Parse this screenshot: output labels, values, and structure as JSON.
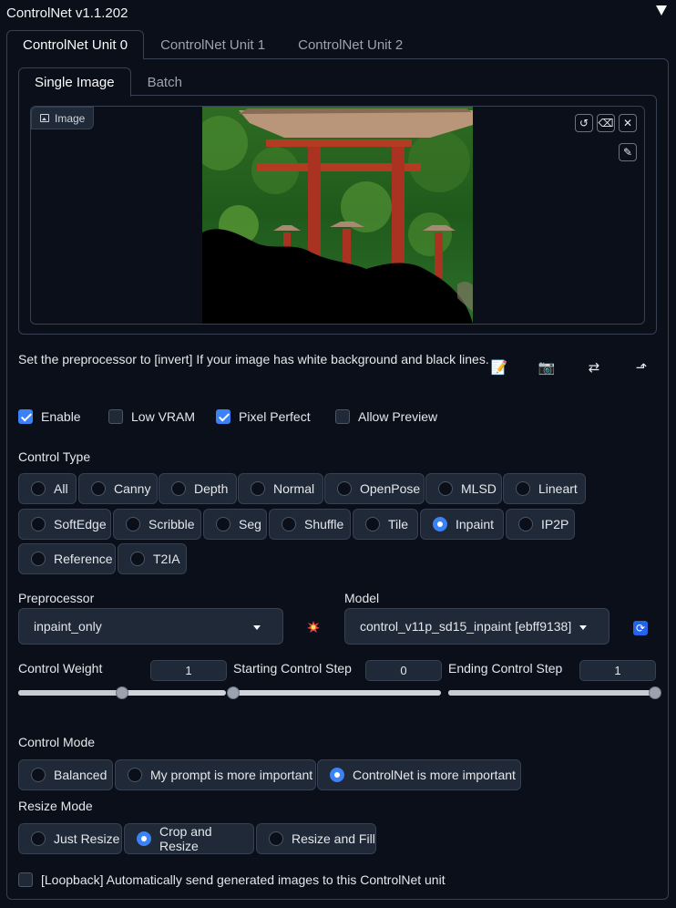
{
  "accordion": {
    "title": "ControlNet v1.1.202"
  },
  "unit_tabs": [
    "ControlNet Unit 0",
    "ControlNet Unit 1",
    "ControlNet Unit 2"
  ],
  "sub_tabs": [
    "Single Image",
    "Batch"
  ],
  "image": {
    "label": "Image"
  },
  "hint": "Set the preprocessor to [invert] If your image has white background and black lines.",
  "checks": {
    "enable": "Enable",
    "low_vram": "Low VRAM",
    "pixel_perfect": "Pixel Perfect",
    "allow_preview": "Allow Preview"
  },
  "check_states": {
    "enable": true,
    "low_vram": false,
    "pixel_perfect": true,
    "allow_preview": false
  },
  "control_type": {
    "label": "Control Type",
    "options": [
      "All",
      "Canny",
      "Depth",
      "Normal",
      "OpenPose",
      "MLSD",
      "Lineart",
      "SoftEdge",
      "Scribble",
      "Seg",
      "Shuffle",
      "Tile",
      "Inpaint",
      "IP2P",
      "Reference",
      "T2IA"
    ],
    "selected": "Inpaint"
  },
  "preprocessor": {
    "label": "Preprocessor",
    "value": "inpaint_only"
  },
  "model": {
    "label": "Model",
    "value": "control_v11p_sd15_inpaint [ebff9138]"
  },
  "sliders": {
    "weight": {
      "label": "Control Weight",
      "value": "1",
      "fraction": 0.5
    },
    "start": {
      "label": "Starting Control Step",
      "value": "0",
      "fraction": 0
    },
    "end": {
      "label": "Ending Control Step",
      "value": "1",
      "fraction": 1
    }
  },
  "control_mode": {
    "label": "Control Mode",
    "options": [
      "Balanced",
      "My prompt is more important",
      "ControlNet is more important"
    ],
    "selected": "ControlNet is more important"
  },
  "resize_mode": {
    "label": "Resize Mode",
    "options": [
      "Just Resize",
      "Crop and Resize",
      "Resize and Fill"
    ],
    "selected": "Crop and Resize"
  },
  "loopback": {
    "label": "[Loopback] Automatically send generated images to this ControlNet unit",
    "checked": false
  },
  "colors": {
    "accent": "#3b82f6",
    "background": "#0b0f19",
    "panel": "#1f2937"
  }
}
